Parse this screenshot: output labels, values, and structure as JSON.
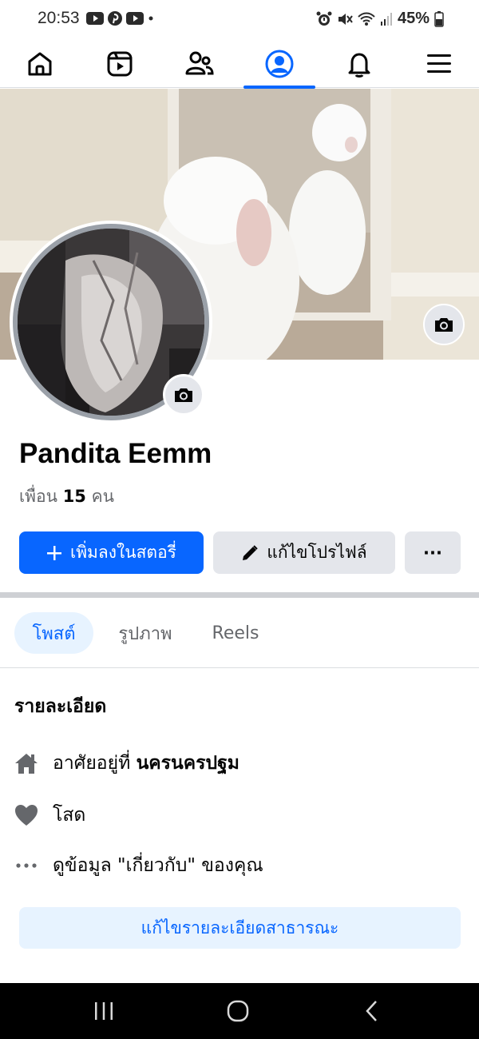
{
  "status_bar": {
    "time": "20:53",
    "battery": "45%",
    "app_icons": [
      "youtube-icon",
      "pinterest-icon",
      "youtube-icon"
    ],
    "system_icons": [
      "alarm-icon",
      "mute-icon",
      "wifi-icon",
      "signal-icon",
      "battery-icon"
    ]
  },
  "nav": {
    "items": [
      {
        "name": "home-icon"
      },
      {
        "name": "video-icon"
      },
      {
        "name": "friends-icon"
      },
      {
        "name": "profile-icon",
        "active": true
      },
      {
        "name": "bell-icon"
      },
      {
        "name": "menu-icon"
      }
    ]
  },
  "profile": {
    "name": "Pandita Eemm",
    "friends_prefix": "เพื่อน",
    "friends_count": "15",
    "friends_suffix": "คน"
  },
  "actions": {
    "add_story": "เพิ่มลงในสตอรี่",
    "edit_profile": "แก้ไขโปรไฟล์",
    "more": "···"
  },
  "tabs": [
    "โพสต์",
    "รูปภาพ",
    "Reels"
  ],
  "details": {
    "title": "รายละเอียด",
    "lives_prefix": "อาศัยอยู่ที่",
    "lives_city": "นครนครปฐม",
    "relationship": "โสด",
    "about_link": "ดูข้อมูล \"เกี่ยวกับ\" ของคุณ",
    "edit_public_button": "แก้ไขรายละเอียดสาธารณะ"
  },
  "colors": {
    "accent": "#0866ff",
    "button_gray": "#e4e6eb",
    "light_blue": "#e7f3ff",
    "text_secondary": "#65676b"
  }
}
